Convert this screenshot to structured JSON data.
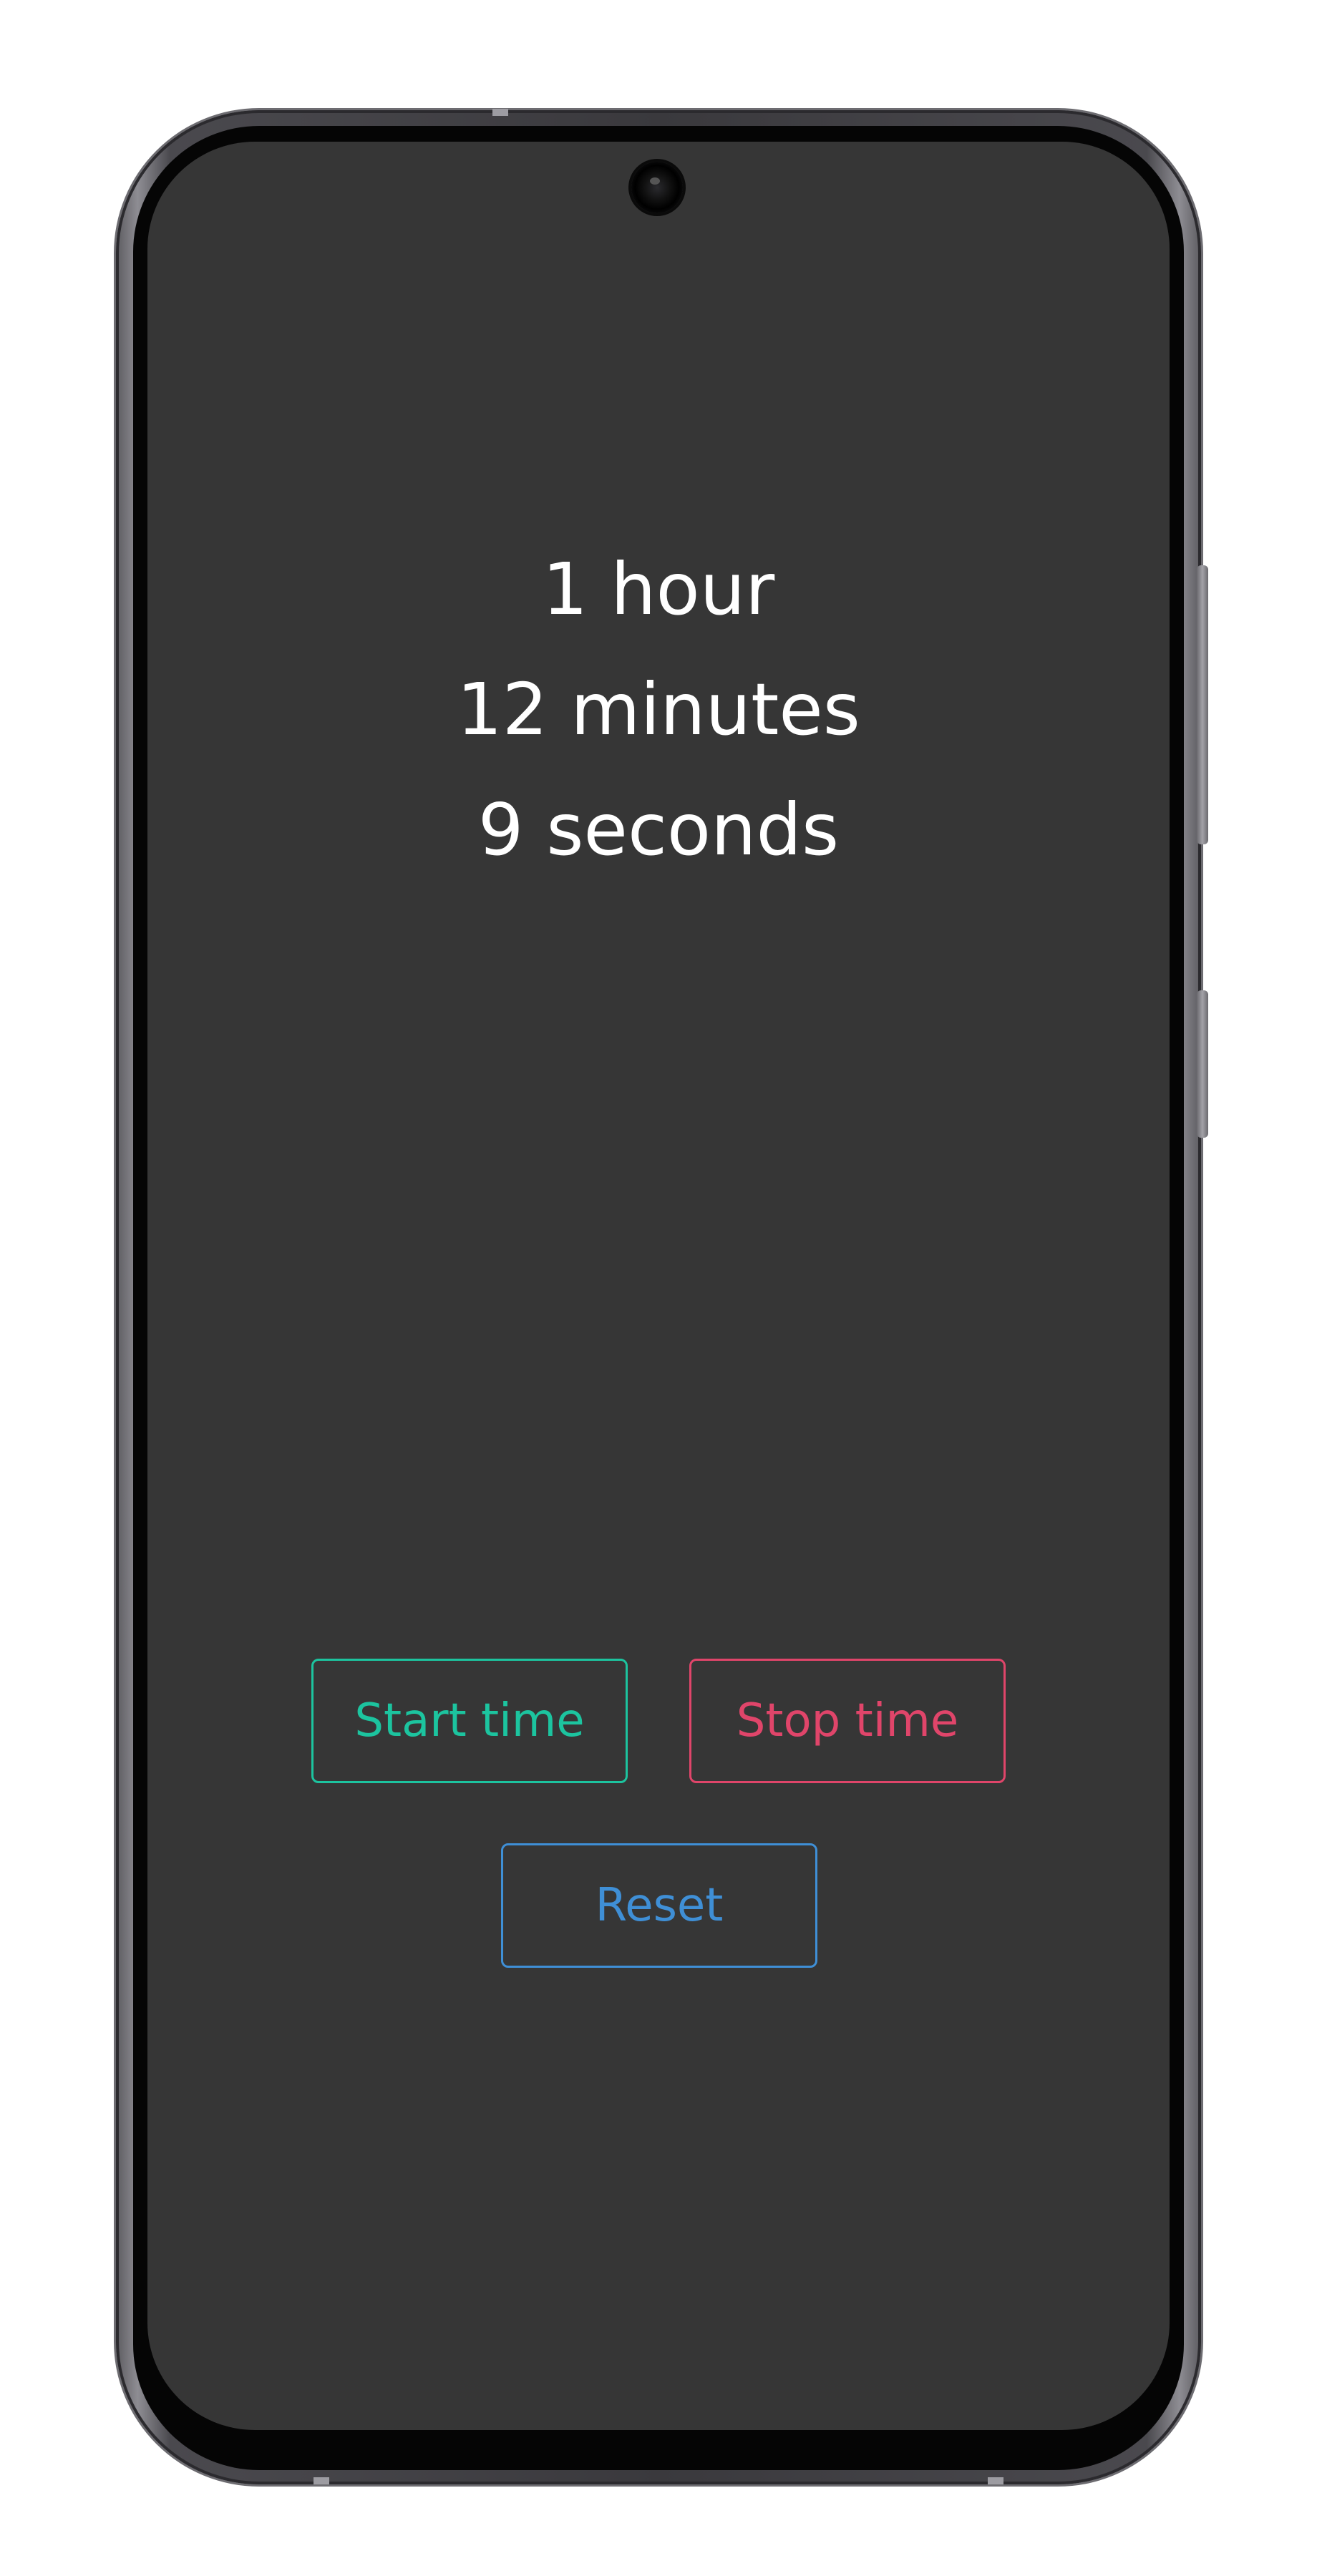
{
  "timer": {
    "hours_text": "1 hour",
    "minutes_text": "12 minutes",
    "seconds_text": "9 seconds"
  },
  "controls": {
    "start_label": "Start time",
    "stop_label": "Stop time",
    "reset_label": "Reset"
  },
  "colors": {
    "screen_background": "#363636",
    "start_accent": "#1cc49f",
    "stop_accent": "#e0456a",
    "reset_accent": "#3f8fd6",
    "timer_text": "#ffffff"
  }
}
